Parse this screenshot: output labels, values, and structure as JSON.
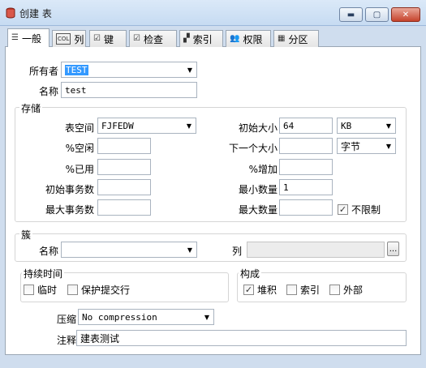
{
  "window": {
    "title": "创建 表"
  },
  "tabs": [
    {
      "label": "一般",
      "icon": "general-icon"
    },
    {
      "label": "列",
      "icon": "column-icon"
    },
    {
      "label": "键",
      "icon": "key-icon"
    },
    {
      "label": "检查",
      "icon": "check-icon"
    },
    {
      "label": "索引",
      "icon": "index-icon"
    },
    {
      "label": "权限",
      "icon": "privilege-icon"
    },
    {
      "label": "分区",
      "icon": "partition-icon"
    }
  ],
  "general": {
    "owner_label": "所有者",
    "owner_value": "TEST",
    "name_label": "名称",
    "name_value": "test"
  },
  "storage": {
    "title": "存储",
    "tablespace_label": "表空间",
    "tablespace_value": "FJFEDW",
    "pctfree_label": "%空闲",
    "pctfree_value": "",
    "pctused_label": "%已用",
    "pctused_value": "",
    "initrans_label": "初始事务数",
    "initrans_value": "",
    "maxtrans_label": "最大事务数",
    "maxtrans_value": "",
    "initial_label": "初始大小",
    "initial_value": "64",
    "initial_unit": "KB",
    "next_label": "下一个大小",
    "next_value": "",
    "next_unit": "字节",
    "pctincrease_label": "%增加",
    "pctincrease_value": "",
    "minextents_label": "最小数量",
    "minextents_value": "1",
    "maxextents_label": "最大数量",
    "maxextents_value": "",
    "unlimited_label": "不限制",
    "unlimited_checked": true
  },
  "cluster": {
    "title": "簇",
    "name_label": "名称",
    "name_value": "",
    "columns_label": "列",
    "columns_value": "",
    "browse_label": "..."
  },
  "duration": {
    "title": "持续时间",
    "temporary_label": "临时",
    "temporary_checked": false,
    "preserve_label": "保护提交行",
    "preserve_checked": false
  },
  "organization": {
    "title": "构成",
    "heap_label": "堆积",
    "heap_checked": true,
    "index_label": "索引",
    "index_checked": false,
    "external_label": "外部",
    "external_checked": false
  },
  "compression": {
    "label": "压缩",
    "value": "No compression"
  },
  "comment": {
    "label": "注释",
    "value": "建表测试"
  },
  "colors": {
    "selection": "#3399ff",
    "frame": "#cfddee",
    "close": "#c6432c"
  }
}
